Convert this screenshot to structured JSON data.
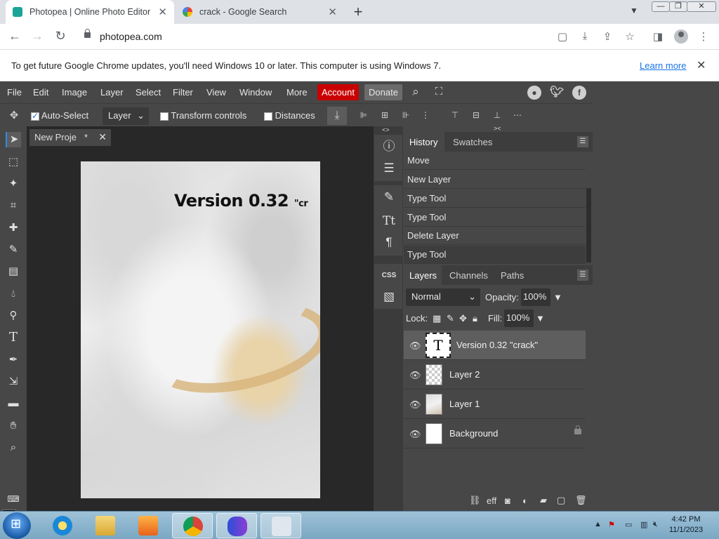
{
  "browser": {
    "tabs": [
      {
        "title": "Photopea | Online Photo Editor",
        "active": true
      },
      {
        "title": "crack - Google Search",
        "active": false
      }
    ],
    "new_tab": "+",
    "tab_close": "✕",
    "window_controls": {
      "minimize": "—",
      "restore": "❐",
      "close": "✕"
    },
    "url": "photopea.com",
    "infobar": {
      "message": "To get future Google Chrome updates, you'll need Windows 10 or later. This computer is using Windows 7.",
      "link": "Learn more",
      "close": "✕"
    }
  },
  "photopea": {
    "menu": [
      "File",
      "Edit",
      "Image",
      "Layer",
      "Select",
      "Filter",
      "View",
      "Window",
      "More"
    ],
    "account": "Account",
    "donate": "Donate",
    "account_color": "#c90000",
    "options": {
      "auto_select": "Auto-Select",
      "auto_select_checked": true,
      "target": "Layer",
      "transform_controls": "Transform controls",
      "distances": "Distances"
    },
    "document_tab": {
      "title": "New Proje",
      "modified": "*",
      "close": "✕"
    },
    "canvas": {
      "headline": "Version 0.32",
      "fragment": "\"cr"
    },
    "history": {
      "tabs": [
        "History",
        "Swatches"
      ],
      "items": [
        "Move",
        "New Layer",
        "Type Tool",
        "Type Tool",
        "Delete Layer",
        "Type Tool"
      ]
    },
    "layers": {
      "tabs": [
        "Layers",
        "Channels",
        "Paths"
      ],
      "blend_mode": "Normal",
      "opacity_label": "Opacity:",
      "opacity": "100%",
      "lock_label": "Lock:",
      "fill_label": "Fill:",
      "fill": "100%",
      "items": [
        {
          "name": "Version 0.32 \"crack\"",
          "kind": "text",
          "selected": true
        },
        {
          "name": "Layer 2",
          "kind": "empty",
          "selected": false
        },
        {
          "name": "Layer 1",
          "kind": "photo",
          "selected": false
        },
        {
          "name": "Background",
          "kind": "white",
          "selected": false,
          "locked": true
        }
      ],
      "text_thumb": "T",
      "footer_effects": "eff"
    },
    "panel_menu": "☰",
    "collapse_top": "<>",
    "collapse_top_right": "><"
  },
  "taskbar": {
    "time": "4:42 PM",
    "date": "11/1/2023"
  }
}
